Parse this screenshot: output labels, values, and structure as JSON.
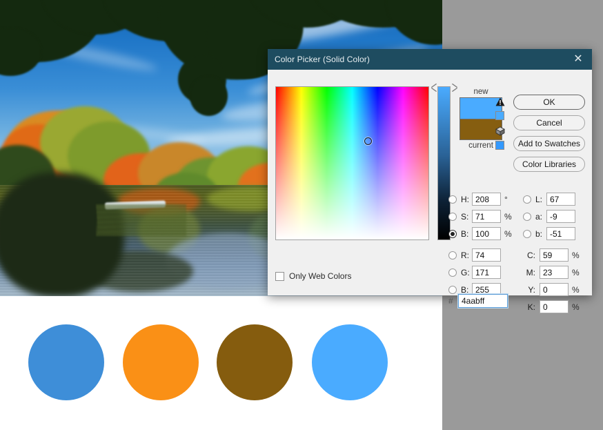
{
  "dialog": {
    "title": "Color Picker (Solid Color)",
    "close_icon": "close-icon",
    "buttons": {
      "ok": "OK",
      "cancel": "Cancel",
      "add_to_swatches": "Add to Swatches",
      "color_libraries": "Color Libraries"
    },
    "only_web_colors": {
      "label": "Only Web Colors",
      "checked": false
    },
    "preview": {
      "new_label": "new",
      "current_label": "current",
      "new_color": "#4aabff",
      "current_color": "#865e10",
      "gamut_warning_icon": "warning-triangle-icon",
      "gamut_warning_color": "#4aabff",
      "web_safe_icon": "cube-icon",
      "web_safe_color": "#3399ff"
    },
    "selected_mode": "B",
    "hsb": [
      {
        "id": "H",
        "label": "H:",
        "value": "208",
        "unit": "°",
        "selected": false
      },
      {
        "id": "S",
        "label": "S:",
        "value": "71",
        "unit": "%",
        "selected": false
      },
      {
        "id": "B",
        "label": "B:",
        "value": "100",
        "unit": "%",
        "selected": true
      }
    ],
    "rgb": [
      {
        "id": "R",
        "label": "R:",
        "value": "74",
        "unit": "",
        "selected": false
      },
      {
        "id": "G",
        "label": "G:",
        "value": "171",
        "unit": "",
        "selected": false
      },
      {
        "id": "B2",
        "label": "B:",
        "value": "255",
        "unit": "",
        "selected": false
      }
    ],
    "lab": [
      {
        "id": "L",
        "label": "L:",
        "value": "67",
        "unit": "",
        "selected": false
      },
      {
        "id": "a",
        "label": "a:",
        "value": "-9",
        "unit": "",
        "selected": false
      },
      {
        "id": "b",
        "label": "b:",
        "value": "-51",
        "unit": "",
        "selected": false
      }
    ],
    "cmyk": [
      {
        "id": "C",
        "label": "C:",
        "value": "59",
        "unit": "%"
      },
      {
        "id": "M",
        "label": "M:",
        "value": "23",
        "unit": "%"
      },
      {
        "id": "Y",
        "label": "Y:",
        "value": "0",
        "unit": "%"
      },
      {
        "id": "K",
        "label": "K:",
        "value": "0",
        "unit": "%"
      }
    ],
    "hex": {
      "prefix": "#",
      "value": "4aabff"
    },
    "field": {
      "marker_x_pct": 60.5,
      "marker_y_pct": 35.4
    },
    "slider": {
      "value_pct": 100,
      "top_color": "#4aabff",
      "bottom_color": "#000000"
    },
    "titlebar_color": "#1e4c60"
  },
  "canvas": {
    "background": "#ffffff",
    "app_background": "#9a9a9a",
    "photo": {
      "description": "autumn lake landscape with blue sky",
      "sky_color": "#2077c8",
      "water_color": "#6d8aa6",
      "foliage_color": "#d4741a"
    },
    "circles": [
      {
        "name": "circle-1",
        "color": "#3e8ed8"
      },
      {
        "name": "circle-2",
        "color": "#fa9016"
      },
      {
        "name": "circle-3",
        "color": "#855c0e"
      },
      {
        "name": "circle-4",
        "color": "#4aabff"
      }
    ]
  }
}
